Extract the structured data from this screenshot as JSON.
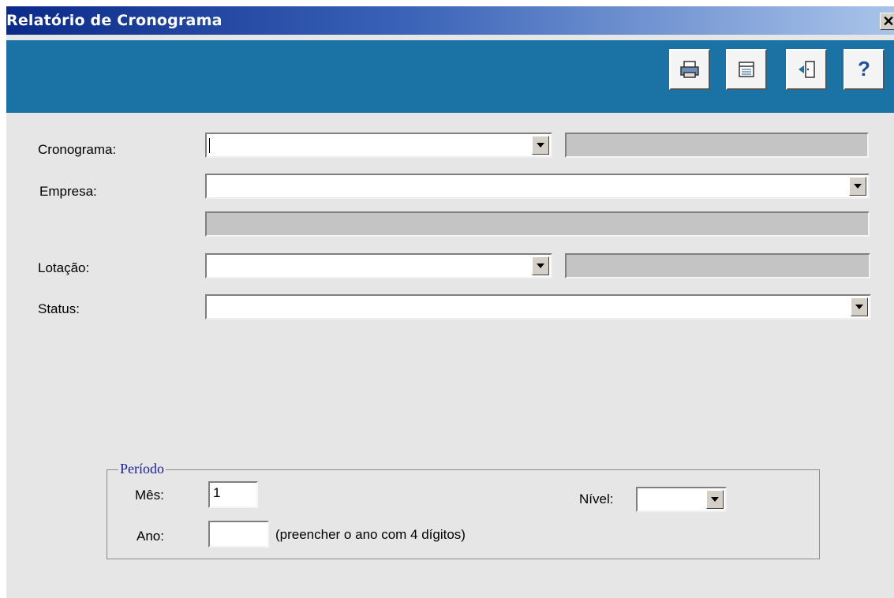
{
  "window": {
    "title": "Relatório de Cronograma",
    "close_glyph": "✕"
  },
  "toolbar": {
    "buttons": [
      {
        "icon": "printer-icon"
      },
      {
        "icon": "report-icon"
      },
      {
        "icon": "exit-door-icon"
      },
      {
        "icon": "help-icon",
        "glyph": "?"
      }
    ],
    "background": "#1b72a4"
  },
  "form": {
    "cronograma_label": "Cronograma:",
    "empresa_label": "Empresa:",
    "lotacao_label": "Lotação:",
    "status_label": "Status:",
    "cronograma_value": "",
    "empresa_value": "",
    "lotacao_value": "",
    "status_value": ""
  },
  "periodo": {
    "legend": "Período",
    "mes_label": "Mês:",
    "mes_value": "1",
    "ano_label": "Ano:",
    "ano_value": "",
    "ano_hint": "(preencher o ano com 4 dígitos)",
    "nivel_label": "Nível:",
    "nivel_value": ""
  }
}
